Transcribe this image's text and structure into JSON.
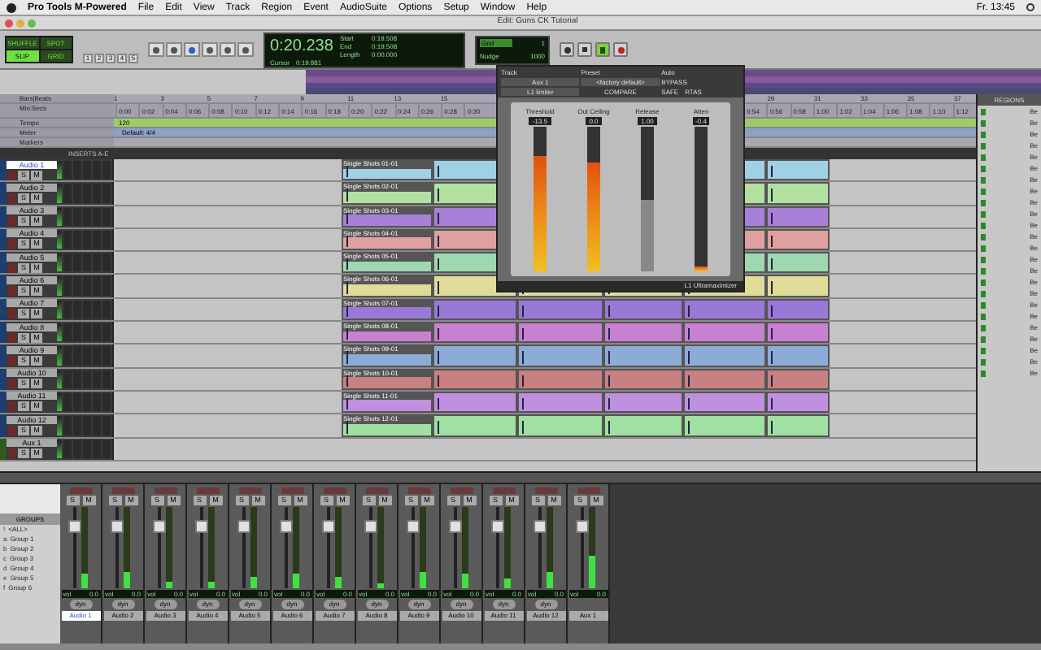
{
  "menu_bar": {
    "app": "Pro Tools M-Powered",
    "items": [
      "File",
      "Edit",
      "View",
      "Track",
      "Region",
      "Event",
      "AudioSuite",
      "Options",
      "Setup",
      "Window",
      "Help"
    ],
    "clock": "Fr. 13:45"
  },
  "window": {
    "title": "Edit: Guns CK Tutorial"
  },
  "toolbar": {
    "modes": [
      {
        "label": "SHUFFLE",
        "selected": false
      },
      {
        "label": "SPOT",
        "selected": false
      },
      {
        "label": "SLIP",
        "selected": true
      },
      {
        "label": "GRID",
        "selected": false
      }
    ],
    "zoom_presets": [
      "1",
      "2",
      "3",
      "4",
      "5"
    ],
    "counter": "0:20.238",
    "fields": [
      {
        "label": "Start",
        "value": "0:19.508"
      },
      {
        "label": "End",
        "value": "0:19.508"
      },
      {
        "label": "Length",
        "value": "0:00.000"
      }
    ],
    "cursor": {
      "label": "Cursor",
      "value": "0:19.881"
    },
    "grid": {
      "label": "Grid",
      "value": "1"
    },
    "nudge": {
      "label": "Nudge",
      "value": "1000"
    },
    "transport": [
      {
        "kind": "rewind",
        "on": false
      },
      {
        "kind": "stop",
        "on": false
      },
      {
        "kind": "play",
        "on": true
      },
      {
        "kind": "record",
        "on": false
      }
    ]
  },
  "rulers": {
    "bars_label": "Bars|Beats",
    "bars": [
      "1",
      "3",
      "5",
      "7",
      "9",
      "11",
      "13",
      "15"
    ],
    "bars_after_plugin": [
      "29",
      "31",
      "33",
      "35",
      "37"
    ],
    "minsecs_label": "Min:Secs",
    "minsecs": [
      "0:00",
      "0:02",
      "0:04",
      "0:06",
      "0:08",
      "0:10",
      "0:12",
      "0:14",
      "0:16",
      "0:18",
      "0:20",
      "0:22",
      "0:24",
      "0:26",
      "0:28",
      "0:30"
    ],
    "minsecs_after_plugin": [
      "0:54",
      "0:56",
      "0:58",
      "1:00",
      "1:02",
      "1:04",
      "1:06",
      "1:08",
      "1:10",
      "1:12"
    ],
    "tempo_label": "Tempo",
    "tempo": "120",
    "meter_label": "Meter",
    "meter": "Default: 4/4",
    "markers_label": "Markers"
  },
  "inserts_label": "INSERTS A-E",
  "tracks": [
    {
      "name": "Audio 1",
      "selected": true,
      "kind": "audio",
      "solo": "S",
      "mute": "M",
      "color": "#9fd0e6",
      "region": "Single Shots 01-01"
    },
    {
      "name": "Audio 2",
      "selected": false,
      "kind": "audio",
      "solo": "S",
      "mute": "M",
      "color": "#b2e0a0",
      "region": "Single Shots 02-01"
    },
    {
      "name": "Audio 3",
      "selected": false,
      "kind": "audio",
      "solo": "S",
      "mute": "M",
      "color": "#a880d8",
      "region": "Single Shots 03-01"
    },
    {
      "name": "Audio 4",
      "selected": false,
      "kind": "audio",
      "solo": "S",
      "mute": "M",
      "color": "#e0a0a0",
      "region": "Single Shots 04-01"
    },
    {
      "name": "Audio 5",
      "selected": false,
      "kind": "audio",
      "solo": "S",
      "mute": "M",
      "color": "#9ed8b0",
      "region": "Single Shots 05-01"
    },
    {
      "name": "Audio 6",
      "selected": false,
      "kind": "audio",
      "solo": "S",
      "mute": "M",
      "color": "#e0dc98",
      "region": "Single Shots 06-01"
    },
    {
      "name": "Audio 7",
      "selected": false,
      "kind": "audio",
      "solo": "S",
      "mute": "M",
      "color": "#9a78d8",
      "region": "Single Shots 07-01"
    },
    {
      "name": "Audio 8",
      "selected": false,
      "kind": "audio",
      "solo": "S",
      "mute": "M",
      "color": "#c880d0",
      "region": "Single Shots 08-01"
    },
    {
      "name": "Audio 9",
      "selected": false,
      "kind": "audio",
      "solo": "S",
      "mute": "M",
      "color": "#8cacd8",
      "region": "Single Shots 09-01"
    },
    {
      "name": "Audio 10",
      "selected": false,
      "kind": "audio",
      "solo": "S",
      "mute": "M",
      "color": "#c88080",
      "region": "Single Shots 10-01"
    },
    {
      "name": "Audio 11",
      "selected": false,
      "kind": "audio",
      "solo": "S",
      "mute": "M",
      "color": "#c090e0",
      "region": "Single Shots 11-01"
    },
    {
      "name": "Audio 12",
      "selected": false,
      "kind": "audio",
      "solo": "S",
      "mute": "M",
      "color": "#a0e0a0",
      "region": "Single Shots 12-01"
    },
    {
      "name": "Aux 1",
      "selected": false,
      "kind": "aux",
      "solo": "S",
      "mute": "M"
    }
  ],
  "plugin": {
    "track_label": "Track",
    "preset_label": "Preset",
    "auto_label": "Auto",
    "track": "Aux 1",
    "preset": "<factory default>",
    "insert": "L1 limiter",
    "buttons": [
      "BYPASS",
      "COMPARE",
      "SAFE",
      "RTAS"
    ],
    "params": [
      {
        "label": "Threshold",
        "value": "-13.5",
        "level": 0.8
      },
      {
        "label": "Out Ceiling",
        "value": "0.0",
        "level": 0.75
      },
      {
        "label": "Release",
        "value": "1.00",
        "level": 0.5
      },
      {
        "label": "Atten",
        "value": "-0.4",
        "level": 0.03
      }
    ],
    "footer": "L1 Ultramaximizer"
  },
  "regions_panel": {
    "title": "REGIONS",
    "items": [
      "Be",
      "Be",
      "Be",
      "Be",
      "Be",
      "Be",
      "Be",
      "Be",
      "Be",
      "Be",
      "Be",
      "Be",
      "Be",
      "Be",
      "Be",
      "Be",
      "Be",
      "Be",
      "Be",
      "Be",
      "Be",
      "Be",
      "Be",
      "Be"
    ]
  },
  "groups": {
    "title": "GROUPS",
    "items": [
      {
        "id": "!",
        "name": "<ALL>"
      },
      {
        "id": "a",
        "name": "Group 1"
      },
      {
        "id": "b",
        "name": "Group 2"
      },
      {
        "id": "c",
        "name": "Group 3"
      },
      {
        "id": "d",
        "name": "Group 4"
      },
      {
        "id": "e",
        "name": "Group 5"
      },
      {
        "id": "f",
        "name": "Group 6"
      }
    ]
  },
  "mixer": [
    {
      "name": "Audio 1",
      "selected": true,
      "kind": "audio",
      "solo": "S",
      "mute": "M",
      "volume_label": "vol",
      "volume": "0.0",
      "dyn": "dyn",
      "level": 0.18
    },
    {
      "name": "Audio 2",
      "selected": false,
      "kind": "audio",
      "solo": "S",
      "mute": "M",
      "volume_label": "vol",
      "volume": "0.0",
      "dyn": "dyn",
      "level": 0.2
    },
    {
      "name": "Audio 3",
      "selected": false,
      "kind": "audio",
      "solo": "S",
      "mute": "M",
      "volume_label": "vol",
      "volume": "0.0",
      "dyn": "dyn",
      "level": 0.08
    },
    {
      "name": "Audio 4",
      "selected": false,
      "kind": "audio",
      "solo": "S",
      "mute": "M",
      "volume_label": "vol",
      "volume": "0.0",
      "dyn": "dyn",
      "level": 0.08
    },
    {
      "name": "Audio 5",
      "selected": false,
      "kind": "audio",
      "solo": "S",
      "mute": "M",
      "volume_label": "vol",
      "volume": "0.0",
      "dyn": "dyn",
      "level": 0.15
    },
    {
      "name": "Audio 6",
      "selected": false,
      "kind": "audio",
      "solo": "S",
      "mute": "M",
      "volume_label": "vol",
      "volume": "0.0",
      "dyn": "dyn",
      "level": 0.18
    },
    {
      "name": "Audio 7",
      "selected": false,
      "kind": "audio",
      "solo": "S",
      "mute": "M",
      "volume_label": "vol",
      "volume": "0.0",
      "dyn": "dyn",
      "level": 0.15
    },
    {
      "name": "Audio 8",
      "selected": false,
      "kind": "audio",
      "solo": "S",
      "mute": "M",
      "volume_label": "vol",
      "volume": "0.0",
      "dyn": "dyn",
      "level": 0.07
    },
    {
      "name": "Audio 9",
      "selected": false,
      "kind": "audio",
      "solo": "S",
      "mute": "M",
      "volume_label": "vol",
      "volume": "0.0",
      "dyn": "dyn",
      "level": 0.2
    },
    {
      "name": "Audio 10",
      "selected": false,
      "kind": "audio",
      "solo": "S",
      "mute": "M",
      "volume_label": "vol",
      "volume": "0.0",
      "dyn": "dyn",
      "level": 0.18
    },
    {
      "name": "Audio 11",
      "selected": false,
      "kind": "audio",
      "solo": "S",
      "mute": "M",
      "volume_label": "vol",
      "volume": "0.0",
      "dyn": "dyn",
      "level": 0.12
    },
    {
      "name": "Audio 12",
      "selected": false,
      "kind": "audio",
      "solo": "S",
      "mute": "M",
      "volume_label": "vol",
      "volume": "0.0",
      "dyn": "dyn",
      "level": 0.2
    },
    {
      "name": "Aux 1",
      "selected": false,
      "kind": "aux",
      "solo": "S",
      "mute": "M",
      "volume_label": "vol",
      "volume": "0.0",
      "level": 0.4
    }
  ]
}
